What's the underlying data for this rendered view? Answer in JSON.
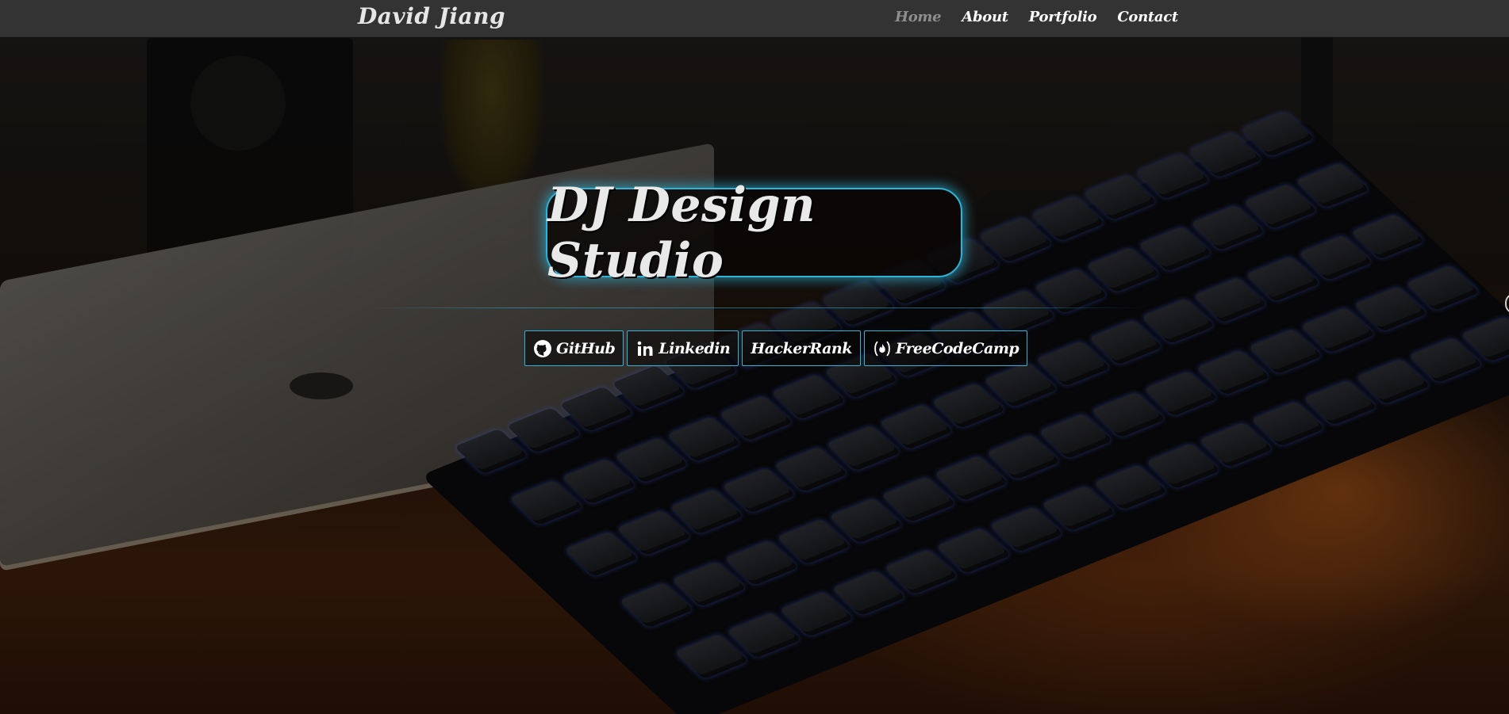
{
  "navbar": {
    "brand": "David Jiang",
    "links": [
      {
        "label": "Home",
        "active": true
      },
      {
        "label": "About",
        "active": false
      },
      {
        "label": "Portfolio",
        "active": false
      },
      {
        "label": "Contact",
        "active": false
      }
    ]
  },
  "hero": {
    "title": "DJ Design Studio"
  },
  "social": [
    {
      "label": "GitHub",
      "icon": "github-icon"
    },
    {
      "label": "Linkedin",
      "icon": "linkedin-icon"
    },
    {
      "label": "HackerRank",
      "icon": ""
    },
    {
      "label": "FreeCodeCamp",
      "icon": "freecodecamp-icon"
    }
  ],
  "colors": {
    "navbar": "#333333",
    "accent": "#2fb3d6",
    "nav_active": "#8e8e8e",
    "text": "#ffffff"
  }
}
